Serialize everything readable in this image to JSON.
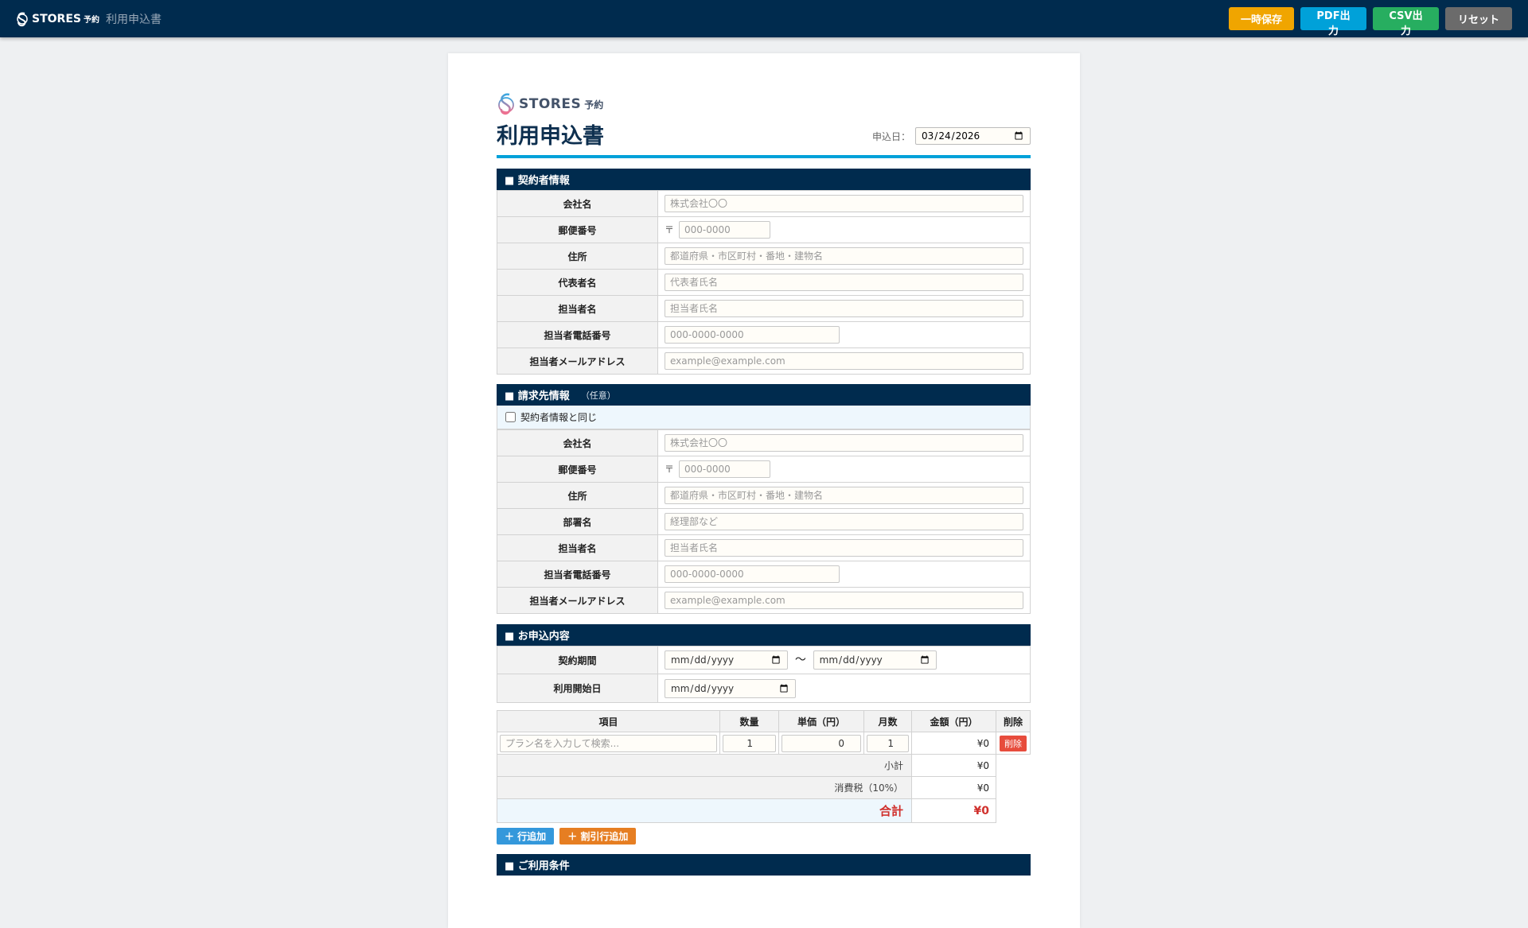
{
  "topbar": {
    "brand": "STORES",
    "brand_sub": "予約",
    "title": "利用申込書",
    "buttons": {
      "save": "一時保存",
      "pdf": "PDF出力",
      "csv": "CSV出力",
      "reset": "リセット"
    }
  },
  "doc": {
    "logo": "STORES",
    "logo_sub": "予約",
    "title": "利用申込書",
    "date_label": "申込日：",
    "date_value": "2026-03-24"
  },
  "contractor": {
    "header": "■ 契約者情報",
    "rows": [
      {
        "label": "会社名",
        "placeholder": "株式会社〇〇"
      },
      {
        "label": "郵便番号",
        "placeholder": "000-0000",
        "prefix": "〒"
      },
      {
        "label": "住所",
        "placeholder": "都道府県・市区町村・番地・建物名"
      },
      {
        "label": "代表者名",
        "placeholder": "代表者氏名"
      },
      {
        "label": "担当者名",
        "placeholder": "担当者氏名"
      },
      {
        "label": "担当者電話番号",
        "placeholder": "000-0000-0000"
      },
      {
        "label": "担当者メールアドレス",
        "placeholder": "example@example.com"
      }
    ]
  },
  "billing": {
    "header": "■ 請求先情報",
    "optional": "（任意）",
    "same_label": "契約者情報と同じ",
    "rows": [
      {
        "label": "会社名",
        "placeholder": "株式会社〇〇"
      },
      {
        "label": "郵便番号",
        "placeholder": "000-0000",
        "prefix": "〒"
      },
      {
        "label": "住所",
        "placeholder": "都道府県・市区町村・番地・建物名"
      },
      {
        "label": "部署名",
        "placeholder": "経理部など"
      },
      {
        "label": "担当者名",
        "placeholder": "担当者氏名"
      },
      {
        "label": "担当者電話番号",
        "placeholder": "000-0000-0000"
      },
      {
        "label": "担当者メールアドレス",
        "placeholder": "example@example.com"
      }
    ]
  },
  "order": {
    "header": "■ お申込内容",
    "period_label": "契約期間",
    "period_sep": "〜",
    "start_label": "利用開始日",
    "columns": [
      "項目",
      "数量",
      "単価（円）",
      "月数",
      "金額（円）",
      "削除"
    ],
    "item": {
      "placeholder": "プラン名を入力して検索...",
      "qty": "1",
      "price": "0",
      "months": "1",
      "amount": "¥0",
      "delete": "削除"
    },
    "subtotal_label": "小計",
    "subtotal": "¥0",
    "tax_label": "消費税（10%）",
    "tax": "¥0",
    "total_label": "合計",
    "total": "¥0",
    "add_row": "＋ 行追加",
    "add_discount": "＋ 割引行追加"
  },
  "terms": {
    "header": "■ ご利用条件"
  }
}
